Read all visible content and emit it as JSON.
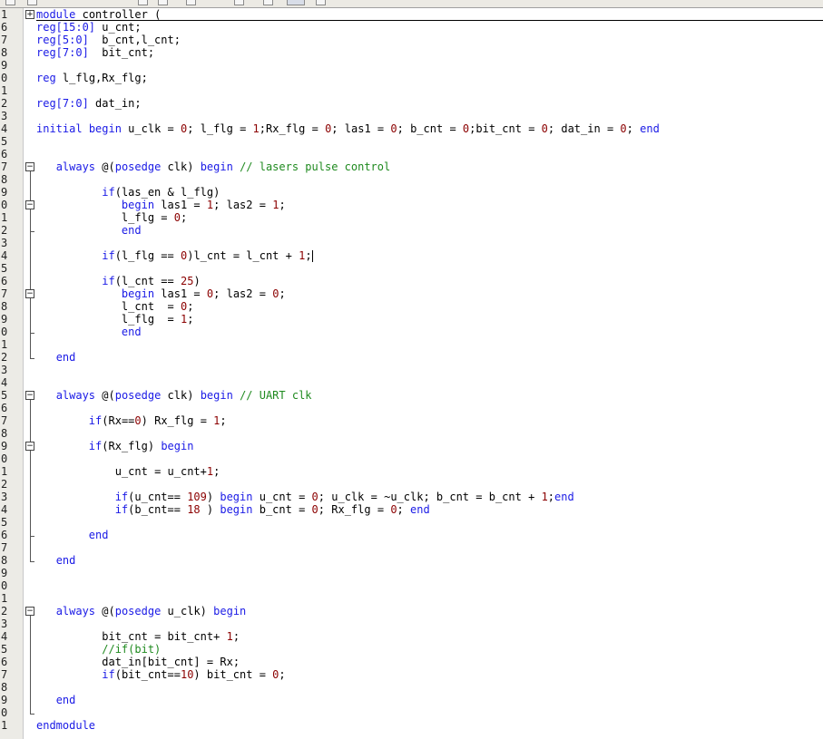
{
  "editor": {
    "lines": [
      {
        "num": "1",
        "code": "module controller (",
        "folded": true
      },
      {
        "num": "6",
        "code": "reg[15:0] u_cnt;"
      },
      {
        "num": "7",
        "code": "reg[5:0]  b_cnt,l_cnt;"
      },
      {
        "num": "8",
        "code": "reg[7:0]  bit_cnt;"
      },
      {
        "num": "9",
        "code": ""
      },
      {
        "num": "0",
        "code": "reg l_flg,Rx_flg;"
      },
      {
        "num": "1",
        "code": ""
      },
      {
        "num": "2",
        "code": "reg[7:0] dat_in;"
      },
      {
        "num": "3",
        "code": ""
      },
      {
        "num": "4",
        "code": "initial begin u_clk = 0; l_flg = 1;Rx_flg = 0; las1 = 0; b_cnt = 0;bit_cnt = 0; dat_in = 0; end"
      },
      {
        "num": "5",
        "code": ""
      },
      {
        "num": "6",
        "code": ""
      },
      {
        "num": "7",
        "code": "   always @(posedge clk) begin // lasers pulse control"
      },
      {
        "num": "8",
        "code": ""
      },
      {
        "num": "9",
        "code": "          if(las_en & l_flg)"
      },
      {
        "num": "0",
        "code": "             begin las1 = 1; las2 = 1;"
      },
      {
        "num": "1",
        "code": "             l_flg = 0;"
      },
      {
        "num": "2",
        "code": "             end"
      },
      {
        "num": "3",
        "code": ""
      },
      {
        "num": "4",
        "code": "          if(l_flg == 0)l_cnt = l_cnt + 1;",
        "cursor": true
      },
      {
        "num": "5",
        "code": ""
      },
      {
        "num": "6",
        "code": "          if(l_cnt == 25)"
      },
      {
        "num": "7",
        "code": "             begin las1 = 0; las2 = 0;"
      },
      {
        "num": "8",
        "code": "             l_cnt  = 0;"
      },
      {
        "num": "9",
        "code": "             l_flg  = 1;"
      },
      {
        "num": "0",
        "code": "             end"
      },
      {
        "num": "1",
        "code": ""
      },
      {
        "num": "2",
        "code": "   end"
      },
      {
        "num": "3",
        "code": ""
      },
      {
        "num": "4",
        "code": ""
      },
      {
        "num": "5",
        "code": "   always @(posedge clk) begin // UART clk"
      },
      {
        "num": "6",
        "code": ""
      },
      {
        "num": "7",
        "code": "        if(Rx==0) Rx_flg = 1;"
      },
      {
        "num": "8",
        "code": ""
      },
      {
        "num": "9",
        "code": "        if(Rx_flg) begin"
      },
      {
        "num": "0",
        "code": ""
      },
      {
        "num": "1",
        "code": "            u_cnt = u_cnt+1;"
      },
      {
        "num": "2",
        "code": ""
      },
      {
        "num": "3",
        "code": "            if(u_cnt== 109) begin u_cnt = 0; u_clk = ~u_clk; b_cnt = b_cnt + 1;end"
      },
      {
        "num": "4",
        "code": "            if(b_cnt== 18 ) begin b_cnt = 0; Rx_flg = 0; end"
      },
      {
        "num": "5",
        "code": ""
      },
      {
        "num": "6",
        "code": "        end"
      },
      {
        "num": "7",
        "code": ""
      },
      {
        "num": "8",
        "code": "   end"
      },
      {
        "num": "9",
        "code": ""
      },
      {
        "num": "0",
        "code": ""
      },
      {
        "num": "1",
        "code": ""
      },
      {
        "num": "2",
        "code": "   always @(posedge u_clk) begin"
      },
      {
        "num": "3",
        "code": ""
      },
      {
        "num": "4",
        "code": "          bit_cnt = bit_cnt+ 1;"
      },
      {
        "num": "5",
        "code": "          //if(bit)"
      },
      {
        "num": "6",
        "code": "          dat_in[bit_cnt] = Rx;"
      },
      {
        "num": "7",
        "code": "          if(bit_cnt==10) bit_cnt = 0;"
      },
      {
        "num": "8",
        "code": ""
      },
      {
        "num": "9",
        "code": "   end"
      },
      {
        "num": "0",
        "code": ""
      },
      {
        "num": "1",
        "code": "endmodule"
      }
    ],
    "fold_expand_glyph": "+",
    "fold_collapse_glyph": "−"
  },
  "colors": {
    "keyword": "#1a1ae6",
    "number": "#8b0000",
    "comment": "#1f8a1f"
  }
}
